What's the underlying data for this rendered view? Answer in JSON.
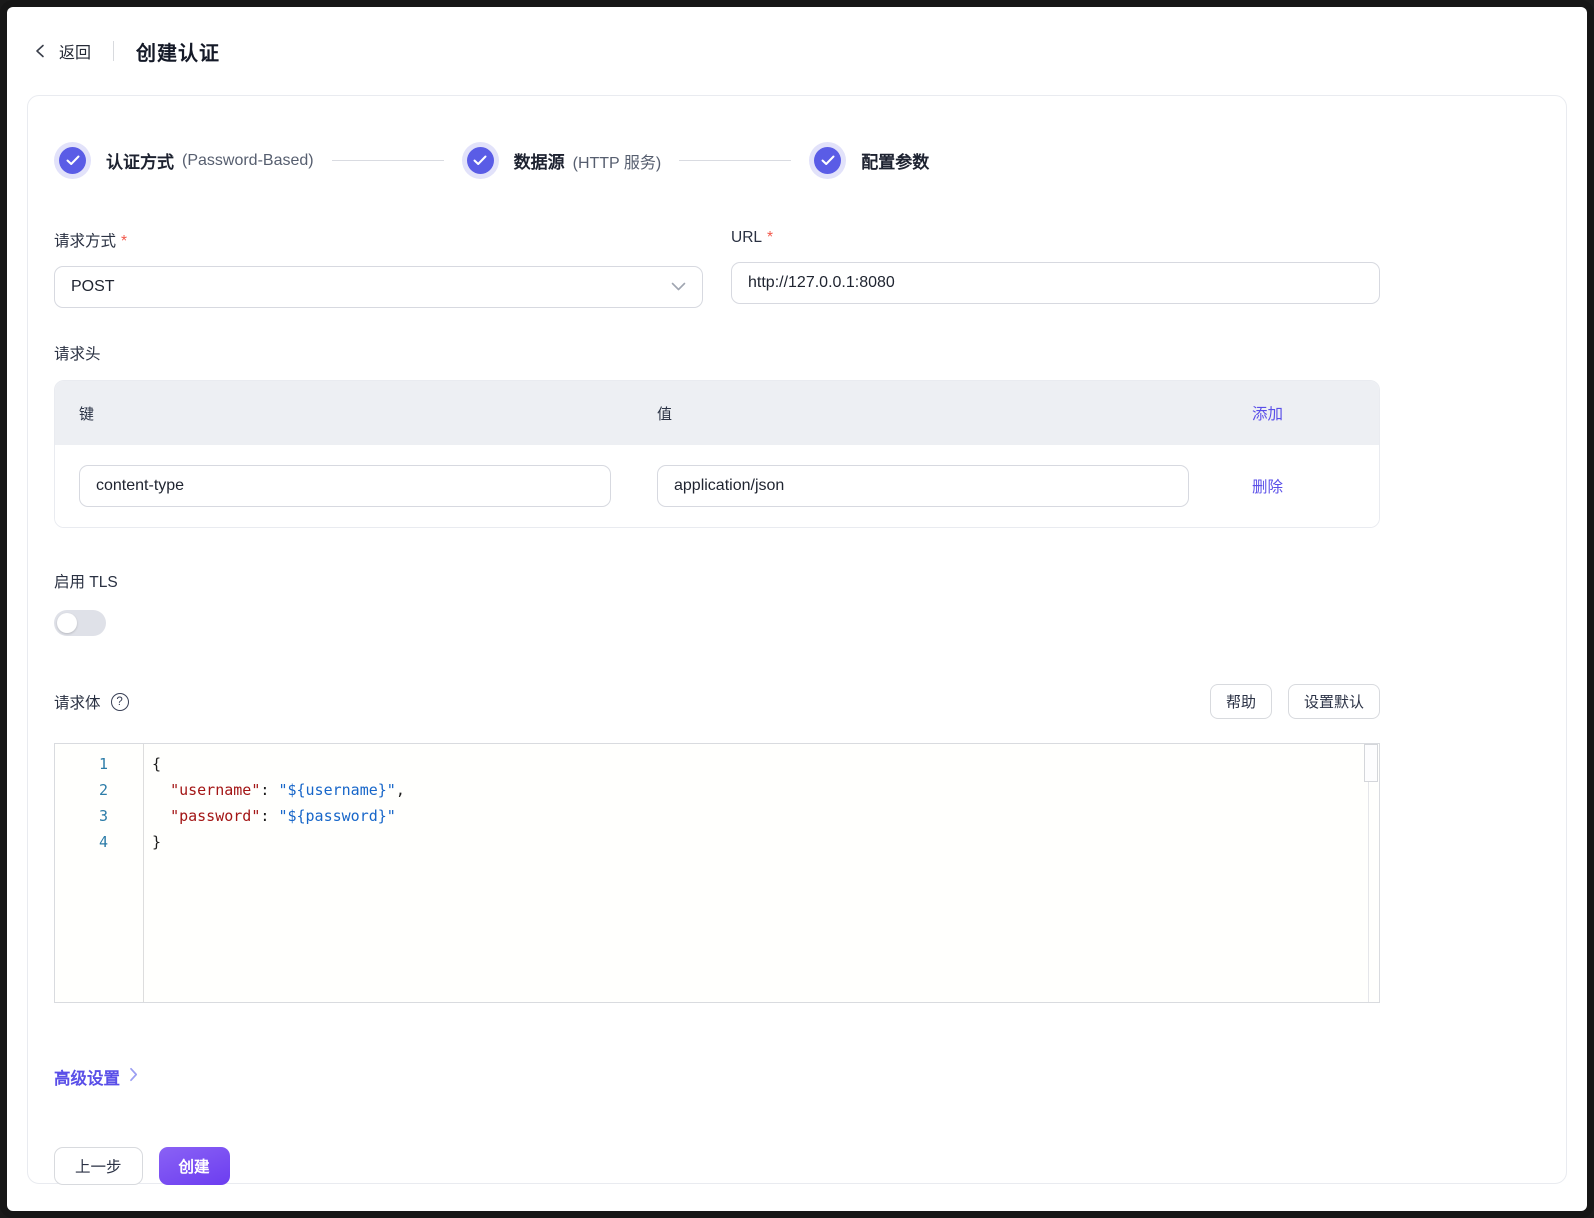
{
  "header": {
    "back_label": "返回",
    "title": "创建认证"
  },
  "stepper": {
    "steps": [
      {
        "label": "认证方式",
        "sublabel": "(Password-Based)"
      },
      {
        "label": "数据源",
        "sublabel": "(HTTP 服务)"
      },
      {
        "label": "配置参数",
        "sublabel": ""
      }
    ]
  },
  "form": {
    "required_mark": "*",
    "method": {
      "label": "请求方式",
      "value": "POST"
    },
    "url": {
      "label": "URL",
      "value": "http://127.0.0.1:8080"
    },
    "headers": {
      "label": "请求头",
      "key_col": "键",
      "value_col": "值",
      "add_label": "添加",
      "rows": [
        {
          "key": "content-type",
          "value": "application/json",
          "delete_label": "删除"
        }
      ]
    },
    "tls": {
      "label": "启用 TLS",
      "enabled": false
    },
    "body": {
      "label": "请求体",
      "help_button": "帮助",
      "set_default_button": "设置默认",
      "line_numbers": [
        "1",
        "2",
        "3",
        "4"
      ],
      "code_lines": [
        {
          "segments": [
            {
              "t": "{"
            }
          ]
        },
        {
          "segments": [
            {
              "t": "  "
            },
            {
              "t": "\"username\""
            },
            {
              "t": ": "
            },
            {
              "t": "\"${username}\""
            },
            {
              "t": ","
            }
          ]
        },
        {
          "segments": [
            {
              "t": "  "
            },
            {
              "t": "\"password\""
            },
            {
              "t": ": "
            },
            {
              "t": "\"${password}\""
            }
          ]
        },
        {
          "segments": [
            {
              "t": "}"
            }
          ]
        }
      ]
    },
    "advanced_label": "高级设置"
  },
  "footer": {
    "prev_label": "上一步",
    "create_label": "创建"
  },
  "colors": {
    "accent": "#5a5ce6",
    "accent_halo": "#e2e2fa",
    "link": "#5a4fe8",
    "create_gradient_top": "#8a62f5",
    "create_gradient_bottom": "#6c3df0",
    "required_mark": "#f2574a",
    "table_header_bg": "#edeff3",
    "code_key": "#a31515",
    "code_value": "#1766c9",
    "code_line_number": "#2c7ca8"
  }
}
